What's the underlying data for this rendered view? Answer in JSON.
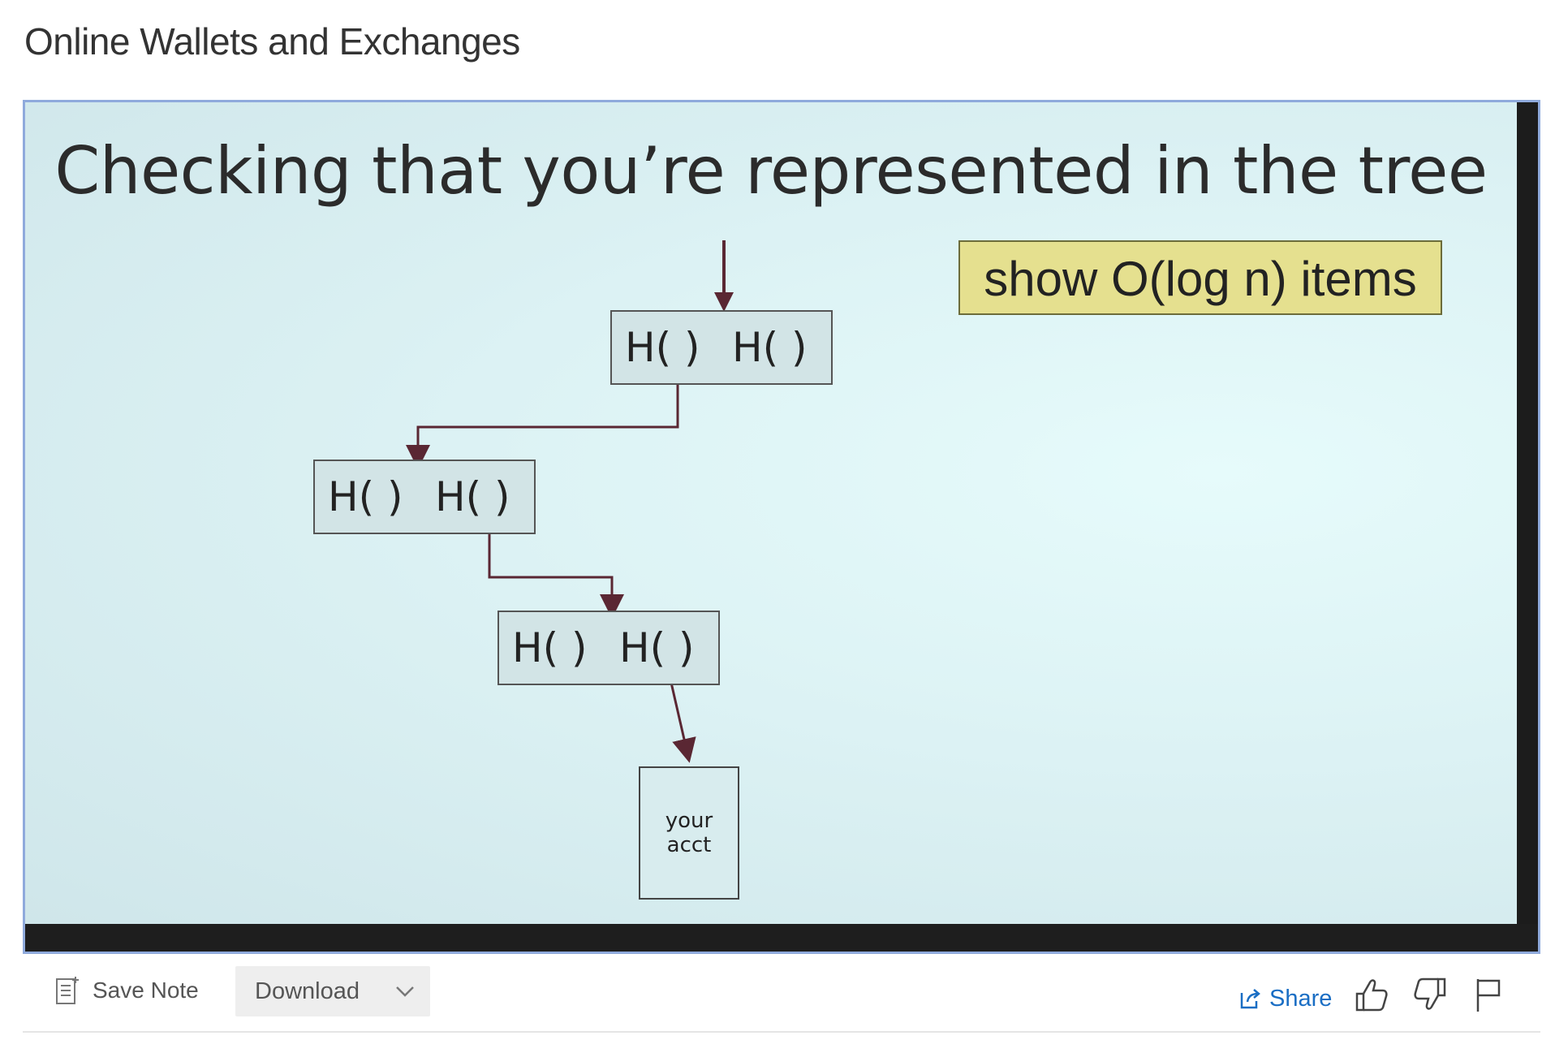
{
  "page": {
    "title": "Online Wallets and Exchanges"
  },
  "slide": {
    "title": "Checking that you’re represented in the tree",
    "callout": "show O(log n) items",
    "nodes": [
      {
        "left": "H(  )",
        "right": "H(  )"
      },
      {
        "left": "H(  )",
        "right": "H(  )"
      },
      {
        "left": "H(  )",
        "right": "H(  )"
      }
    ],
    "leaf": {
      "line1": "your",
      "line2": "acct"
    }
  },
  "toolbar": {
    "save_note_label": "Save Note",
    "save_note_icon": "note-icon",
    "download_label": "Download",
    "download_icon": "chevron-down-icon",
    "share_label": "Share",
    "share_icon": "share-icon",
    "like_icon": "thumbs-up-icon",
    "dislike_icon": "thumbs-down-icon",
    "flag_icon": "flag-icon",
    "link_color": "#1a6ec4"
  }
}
